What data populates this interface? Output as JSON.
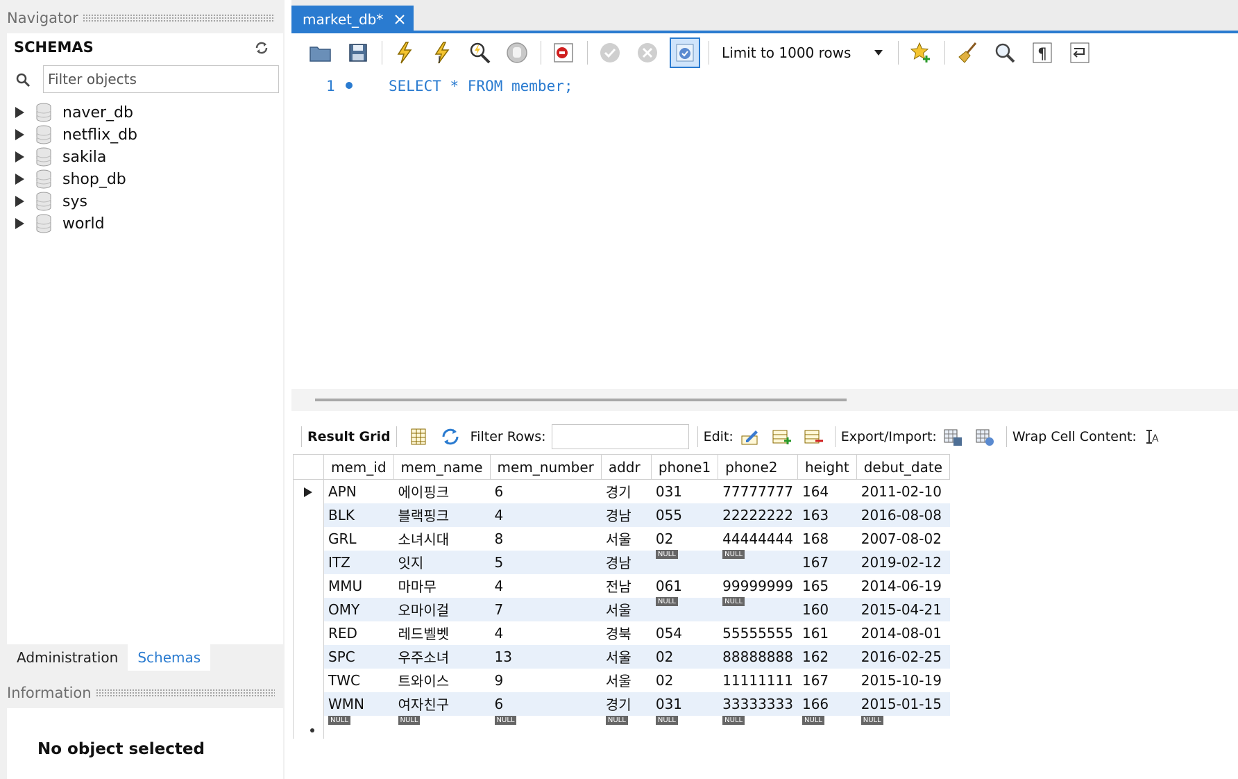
{
  "navigator": {
    "title": "Navigator",
    "schemas_title": "SCHEMAS",
    "filter_placeholder": "Filter objects",
    "schemas": [
      "naver_db",
      "netflix_db",
      "sakila",
      "shop_db",
      "sys",
      "world"
    ]
  },
  "bottom_tabs": {
    "administration": "Administration",
    "schemas": "Schemas"
  },
  "information": {
    "title": "Information",
    "message": "No object selected"
  },
  "editor_tab": {
    "label": "market_db*"
  },
  "toolbar": {
    "limit_label": "Limit to 1000 rows"
  },
  "editor": {
    "line_number": "1",
    "sql": "SELECT * FROM member;"
  },
  "result_toolbar": {
    "result_grid": "Result Grid",
    "filter_rows": "Filter Rows:",
    "edit": "Edit:",
    "export_import": "Export/Import:",
    "wrap_cell": "Wrap Cell Content:"
  },
  "grid": {
    "columns": [
      "mem_id",
      "mem_name",
      "mem_number",
      "addr",
      "phone1",
      "phone2",
      "height",
      "debut_date"
    ],
    "null_label": "NULL",
    "rows": [
      [
        "APN",
        "에이핑크",
        "6",
        "경기",
        "031",
        "77777777",
        "164",
        "2011-02-10"
      ],
      [
        "BLK",
        "블랙핑크",
        "4",
        "경남",
        "055",
        "22222222",
        "163",
        "2016-08-08"
      ],
      [
        "GRL",
        "소녀시대",
        "8",
        "서울",
        "02",
        "44444444",
        "168",
        "2007-08-02"
      ],
      [
        "ITZ",
        "잇지",
        "5",
        "경남",
        null,
        null,
        "167",
        "2019-02-12"
      ],
      [
        "MMU",
        "마마무",
        "4",
        "전남",
        "061",
        "99999999",
        "165",
        "2014-06-19"
      ],
      [
        "OMY",
        "오마이걸",
        "7",
        "서울",
        null,
        null,
        "160",
        "2015-04-21"
      ],
      [
        "RED",
        "레드벨벳",
        "4",
        "경북",
        "054",
        "55555555",
        "161",
        "2014-08-01"
      ],
      [
        "SPC",
        "우주소녀",
        "13",
        "서울",
        "02",
        "88888888",
        "162",
        "2016-02-25"
      ],
      [
        "TWC",
        "트와이스",
        "9",
        "서울",
        "02",
        "11111111",
        "167",
        "2015-10-19"
      ],
      [
        "WMN",
        "여자친구",
        "6",
        "경기",
        "031",
        "33333333",
        "166",
        "2015-01-15"
      ]
    ]
  },
  "colors": {
    "accent": "#2a7bd0",
    "row_alt": "#e8f0fa",
    "panel_bg": "#f0f0f0"
  }
}
